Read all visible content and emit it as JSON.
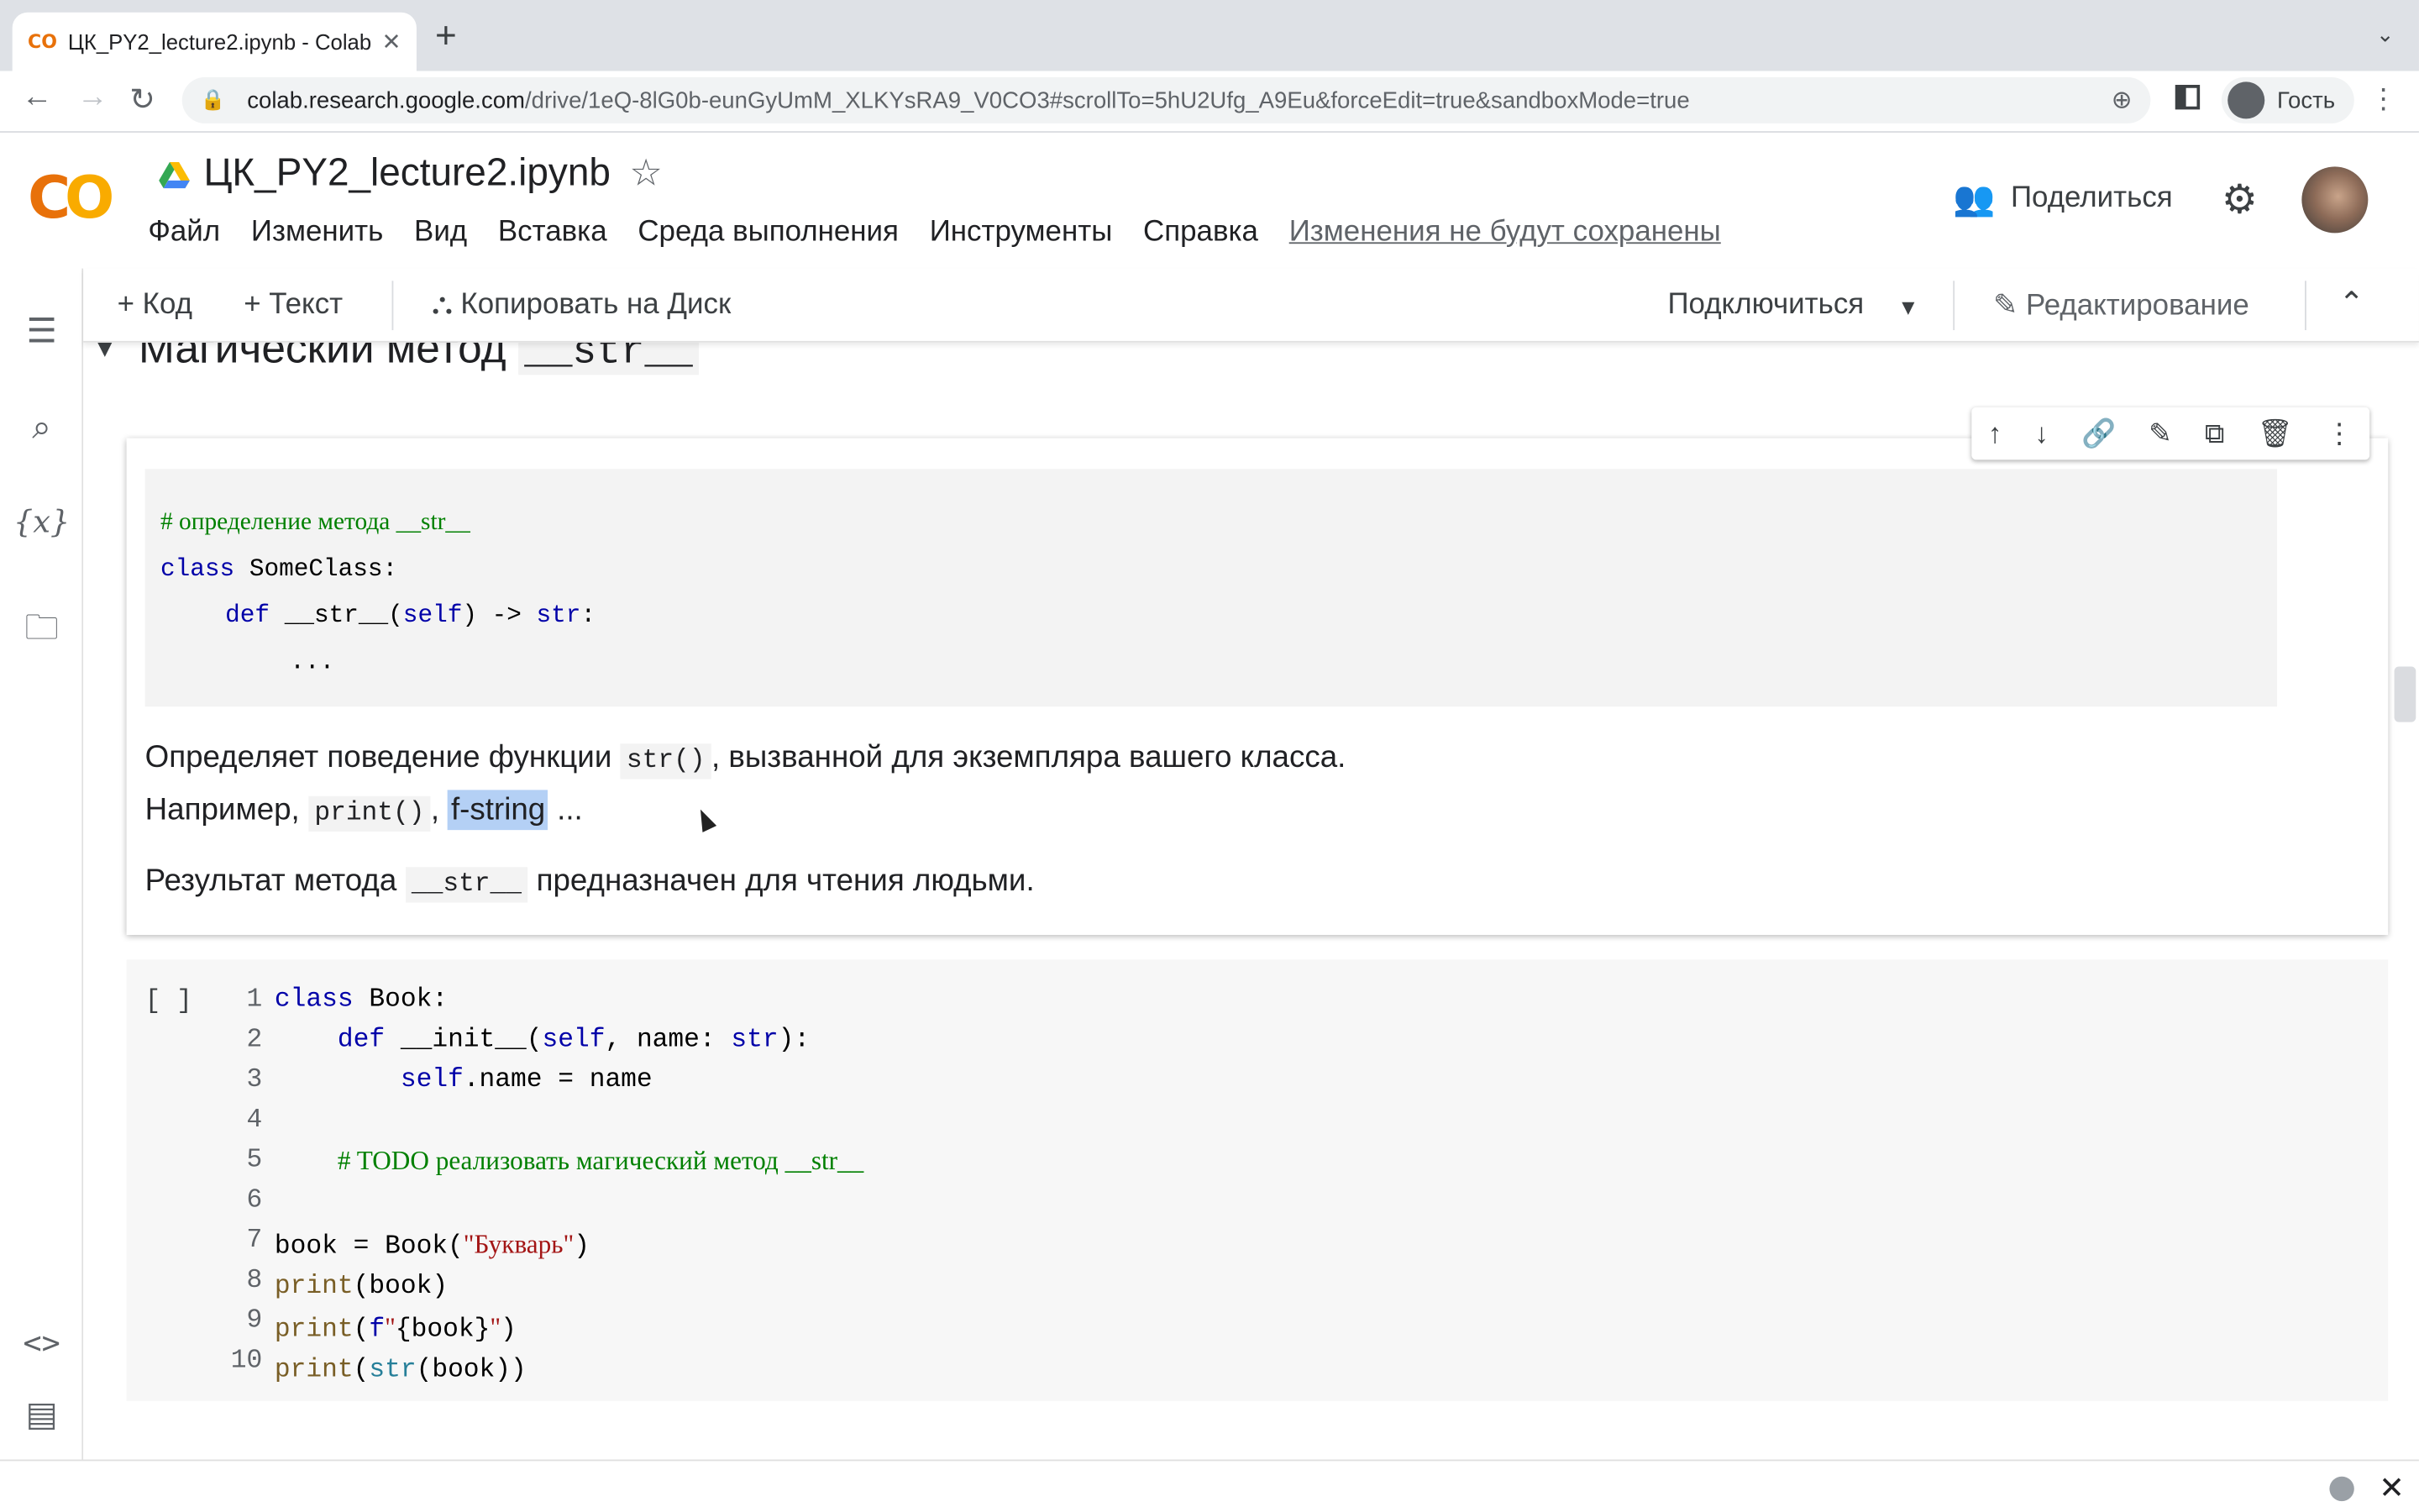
{
  "browser": {
    "tab_favicon": "CO",
    "tab_title": "ЦК_PY2_lecture2.ipynb - Colab",
    "tab_close": "✕",
    "new_tab": "+",
    "url_host": "colab.research.google.com",
    "url_path": "/drive/1eQ-8lG0b-eunGyUmM_XLKYsRA9_V0CO3#scrollTo=5hU2Ufg_A9Eu&forceEdit=true&sandboxMode=true",
    "profile_label": "Гость"
  },
  "header": {
    "logo_part1": "C",
    "logo_part2": "O",
    "notebook_title": "ЦК_PY2_lecture2.ipynb",
    "menu": [
      "Файл",
      "Изменить",
      "Вид",
      "Вставка",
      "Среда выполнения",
      "Инструменты",
      "Справка"
    ],
    "unsaved_notice": "Изменения не будут сохранены",
    "share_label": "Поделиться"
  },
  "toolbar": {
    "add_code": "+ Код",
    "add_text": "+ Текст",
    "copy_to_drive": "Копировать на Диск",
    "connect": "Подключиться",
    "editing": "Редактирование"
  },
  "section": {
    "title_prefix": "Магический метод ",
    "title_code": "__str__"
  },
  "text_cell": {
    "code_comment": "# определение метода __str__",
    "code_line2_kw": "class",
    "code_line2_rest": " SomeClass:",
    "code_line3_kw": "def",
    "code_line3_name": " __str__(",
    "code_line3_self": "self",
    "code_line3_mid": ") -> ",
    "code_line3_type": "str",
    "code_line3_end": ":",
    "code_line4": "...",
    "p1_a": "Определяет поведение функции ",
    "p1_code": "str()",
    "p1_b": ", вызванной для экземпляра вашего класса.",
    "p2_a": "Например, ",
    "p2_code": "print()",
    "p2_sep": ", ",
    "p2_sel": "f-string",
    "p2_end": " ...",
    "p3_a": "Результат метода ",
    "p3_code": "__str__",
    "p3_b": " предназначен для чтения людьми."
  },
  "code_cell": {
    "run_label": "[ ]",
    "line_numbers": [
      "1",
      "2",
      "3",
      "4",
      "5",
      "6",
      "7",
      "8",
      "9",
      "10"
    ]
  },
  "icons": {
    "cell_tools": [
      "arrow-up-icon",
      "arrow-down-icon",
      "link-icon",
      "pencil-icon",
      "mirror-cell-icon",
      "delete-icon",
      "more-vert-icon"
    ]
  }
}
